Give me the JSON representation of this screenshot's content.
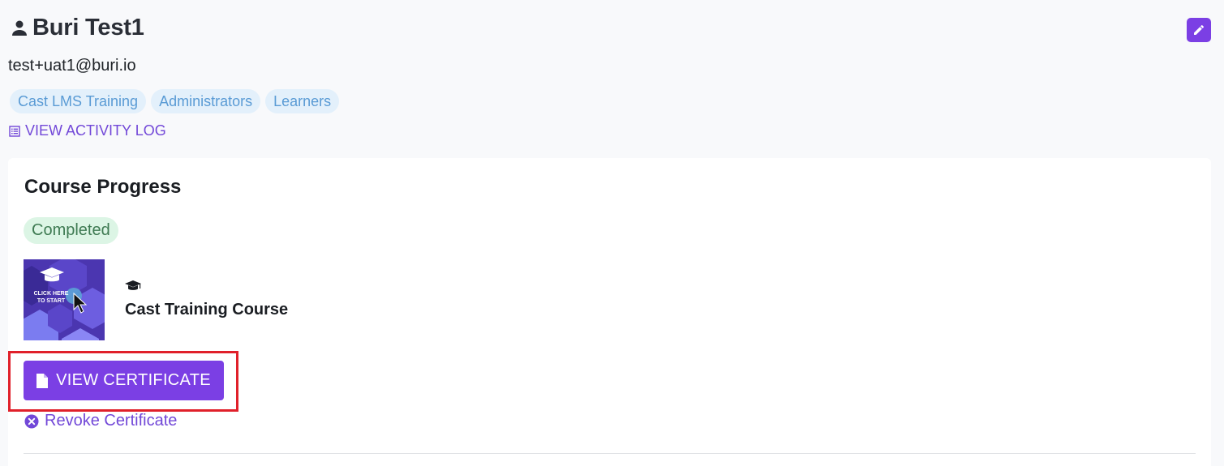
{
  "user": {
    "name": "Buri Test1",
    "email": "test+uat1@buri.io",
    "groups": [
      "Cast LMS Training",
      "Administrators",
      "Learners"
    ]
  },
  "actions": {
    "activity_log_label": "VIEW ACTIVITY LOG",
    "edit_icon": "pencil-icon"
  },
  "course_progress": {
    "title": "Course Progress",
    "status": "Completed",
    "course": {
      "title": "Cast Training Course",
      "thumbnail_text": "CLICK HERE TO START",
      "icon": "graduation-cap-icon"
    },
    "view_certificate_label": "VIEW CERTIFICATE",
    "revoke_certificate_label": "Revoke Certificate"
  },
  "colors": {
    "accent": "#7b3fe4",
    "link": "#7248d8",
    "tag_bg": "#e3f0fb",
    "tag_text": "#5a9bd5",
    "status_bg": "#dcf5e5",
    "status_text": "#3e7a52",
    "highlight": "#e0202a"
  }
}
